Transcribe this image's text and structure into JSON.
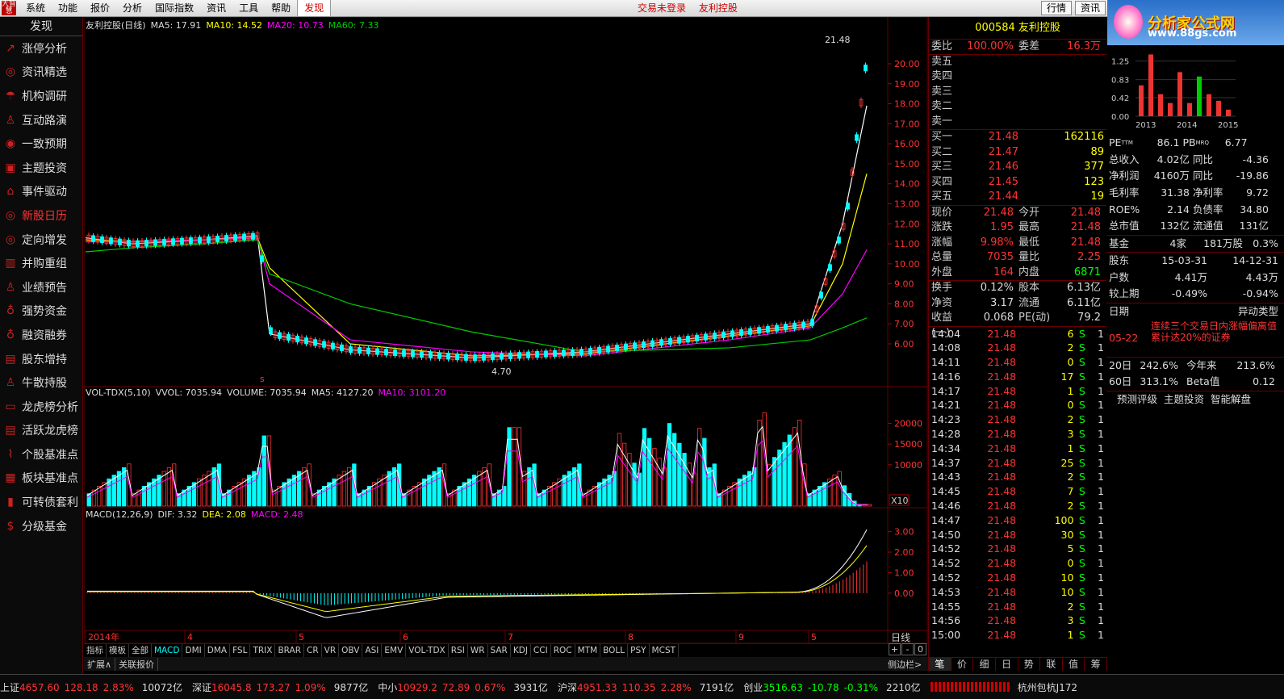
{
  "menubar": {
    "logo": "大智慧",
    "items": [
      "系统",
      "功能",
      "报价",
      "分析",
      "国际指数",
      "资讯",
      "工具",
      "帮助",
      "发现"
    ],
    "active": "发现",
    "center": [
      "交易未登录",
      "友利控股"
    ],
    "right_buttons": [
      "行情",
      "资讯"
    ]
  },
  "brand": {
    "title": "分析家公式网",
    "url": "www.88gs.com"
  },
  "sidebar": {
    "title": "发现",
    "items": [
      {
        "label": "涨停分析",
        "icon": "trend-icon"
      },
      {
        "label": "资讯精选",
        "icon": "globe-icon"
      },
      {
        "label": "机构调研",
        "icon": "umbrella-icon"
      },
      {
        "label": "互动路演",
        "icon": "person-icon"
      },
      {
        "label": "一致预期",
        "icon": "coins-icon"
      },
      {
        "label": "主题投资",
        "icon": "frame-icon"
      },
      {
        "label": "事件驱动",
        "icon": "bank-icon"
      },
      {
        "label": "新股日历",
        "icon": "globe-icon",
        "hot": true
      },
      {
        "label": "定向增发",
        "icon": "globe-icon"
      },
      {
        "label": "并购重组",
        "icon": "building-icon"
      },
      {
        "label": "业绩预告",
        "icon": "person-icon"
      },
      {
        "label": "强势资金",
        "icon": "moneybag-icon"
      },
      {
        "label": "融资融券",
        "icon": "moneybag-icon"
      },
      {
        "label": "股东增持",
        "icon": "doc-icon"
      },
      {
        "label": "牛散持股",
        "icon": "person-icon"
      },
      {
        "label": "龙虎榜分析",
        "icon": "briefcase-icon"
      },
      {
        "label": "活跃龙虎榜",
        "icon": "doc-icon"
      },
      {
        "label": "个股基准点",
        "icon": "chart-icon"
      },
      {
        "label": "板块基准点",
        "icon": "grid-icon"
      },
      {
        "label": "可转债套利",
        "icon": "bars-icon"
      },
      {
        "label": "分级基金",
        "icon": "coin-icon"
      }
    ]
  },
  "chart": {
    "main_title": "友利控股(日线)",
    "ma5": "MA5: 17.91",
    "ma10": "MA10: 14.52",
    "ma20": "MA20: 10.73",
    "ma60": "MA60: 7.33",
    "price_ticks": [
      "20.00",
      "19.00",
      "18.00",
      "17.00",
      "16.00",
      "15.00",
      "14.00",
      "13.00",
      "12.00",
      "11.00",
      "10.00",
      "9.00",
      "8.00",
      "7.00",
      "6.00"
    ],
    "high_label": "21.48",
    "low_label": "4.70",
    "marker_s": "s",
    "vol_title": "VOL-TDX(5,10)",
    "vvol": "VVOL: 7035.94",
    "volume": "VOLUME: 7035.94",
    "vol_ma5": "MA5: 4127.20",
    "vol_ma10": "MA10: 3101.20",
    "vol_ticks": [
      "20000",
      "15000",
      "10000"
    ],
    "vol_unit": "X10",
    "macd_title": "MACD(12,26,9)",
    "dif": "DIF: 3.32",
    "dea": "DEA: 2.08",
    "macd": "MACD: 2.48",
    "macd_ticks": [
      "3.00",
      "2.00",
      "1.00",
      "0.00"
    ],
    "date_labels": [
      "2014年",
      "4",
      "5",
      "6",
      "7",
      "8",
      "9",
      "5"
    ],
    "period": "日线"
  },
  "chart_data": {
    "type": "line",
    "title": "友利控股(日线)",
    "ylim": [
      4.7,
      21.48
    ],
    "x": [
      "2014年",
      "4",
      "5",
      "6",
      "7",
      "8",
      "9",
      "5"
    ],
    "series": [
      {
        "name": "MA5",
        "values": [
          11.3,
          11.0,
          11.2,
          11.4,
          6.5,
          5.7,
          5.3,
          5.6,
          6.5,
          7.0,
          12.0,
          17.9
        ]
      },
      {
        "name": "MA10",
        "values": [
          11.2,
          11.1,
          11.2,
          11.3,
          9.8,
          6.0,
          5.4,
          5.5,
          6.4,
          6.9,
          10.0,
          14.5
        ]
      },
      {
        "name": "MA20",
        "values": [
          11.1,
          11.1,
          11.2,
          11.3,
          9.0,
          6.2,
          5.6,
          5.4,
          6.2,
          6.8,
          8.5,
          10.7
        ]
      },
      {
        "name": "MA60",
        "values": [
          10.6,
          10.8,
          11.0,
          11.2,
          9.5,
          8.0,
          6.6,
          5.6,
          5.8,
          6.2,
          6.8,
          7.3
        ]
      }
    ]
  },
  "tabs": [
    "指标",
    "模板",
    "全部",
    "MACD",
    "DMI",
    "DMA",
    "FSL",
    "TRIX",
    "BRAR",
    "CR",
    "VR",
    "OBV",
    "ASI",
    "EMV",
    "VOL-TDX",
    "RSI",
    "WR",
    "SAR",
    "KDJ",
    "CCI",
    "ROC",
    "MTM",
    "BOLL",
    "PSY",
    "MCST"
  ],
  "active_tab": "MACD",
  "tabs2": [
    "扩展∧",
    "关联报价"
  ],
  "zoom": [
    "+",
    "-",
    "0"
  ],
  "side_toggle": "侧边栏>",
  "quote": {
    "code": "000584",
    "name": "友利控股",
    "weibi_label": "委比",
    "weibi": "100.00%",
    "weicha_label": "委差",
    "weicha": "16.3万",
    "sell": [
      "卖五",
      "卖四",
      "卖三",
      "卖二",
      "卖一"
    ],
    "buy": [
      {
        "l": "买一",
        "p": "21.48",
        "v": "162116"
      },
      {
        "l": "买二",
        "p": "21.47",
        "v": "89"
      },
      {
        "l": "买三",
        "p": "21.46",
        "v": "377"
      },
      {
        "l": "买四",
        "p": "21.45",
        "v": "123"
      },
      {
        "l": "买五",
        "p": "21.44",
        "v": "19"
      }
    ],
    "stats": [
      {
        "a": "现价",
        "b": "21.48",
        "c": "今开",
        "d": "21.48"
      },
      {
        "a": "涨跌",
        "b": "1.95",
        "c": "最高",
        "d": "21.48"
      },
      {
        "a": "涨幅",
        "b": "9.98%",
        "c": "最低",
        "d": "21.48"
      },
      {
        "a": "总量",
        "b": "7035",
        "c": "量比",
        "d": "2.25"
      },
      {
        "a": "外盘",
        "b": "164",
        "c": "内盘",
        "d": "6871"
      }
    ],
    "stats2": [
      {
        "a": "换手",
        "b": "0.12%",
        "c": "股本",
        "d": "6.13亿"
      },
      {
        "a": "净资",
        "b": "3.17",
        "c": "流通",
        "d": "6.11亿"
      },
      {
        "a": "收益(一)",
        "b": "0.068",
        "c": "PE(动)",
        "d": "79.2"
      }
    ],
    "ticks": [
      {
        "t": "14:04",
        "p": "21.48",
        "v": "6",
        "s": "S",
        "n": "1"
      },
      {
        "t": "14:08",
        "p": "21.48",
        "v": "2",
        "s": "S",
        "n": "1"
      },
      {
        "t": "14:11",
        "p": "21.48",
        "v": "0",
        "s": "S",
        "n": "1"
      },
      {
        "t": "14:16",
        "p": "21.48",
        "v": "17",
        "s": "S",
        "n": "1"
      },
      {
        "t": "14:17",
        "p": "21.48",
        "v": "1",
        "s": "S",
        "n": "1"
      },
      {
        "t": "14:21",
        "p": "21.48",
        "v": "0",
        "s": "S",
        "n": "1"
      },
      {
        "t": "14:23",
        "p": "21.48",
        "v": "2",
        "s": "S",
        "n": "1"
      },
      {
        "t": "14:28",
        "p": "21.48",
        "v": "3",
        "s": "S",
        "n": "1"
      },
      {
        "t": "14:34",
        "p": "21.48",
        "v": "1",
        "s": "S",
        "n": "1"
      },
      {
        "t": "14:37",
        "p": "21.48",
        "v": "25",
        "s": "S",
        "n": "1"
      },
      {
        "t": "14:43",
        "p": "21.48",
        "v": "2",
        "s": "S",
        "n": "1"
      },
      {
        "t": "14:45",
        "p": "21.48",
        "v": "7",
        "s": "S",
        "n": "1"
      },
      {
        "t": "14:46",
        "p": "21.48",
        "v": "2",
        "s": "S",
        "n": "1"
      },
      {
        "t": "14:47",
        "p": "21.48",
        "v": "100",
        "s": "S",
        "n": "1"
      },
      {
        "t": "14:50",
        "p": "21.48",
        "v": "30",
        "s": "S",
        "n": "1"
      },
      {
        "t": "14:52",
        "p": "21.48",
        "v": "5",
        "s": "S",
        "n": "1"
      },
      {
        "t": "14:52",
        "p": "21.48",
        "v": "0",
        "s": "S",
        "n": "1"
      },
      {
        "t": "14:52",
        "p": "21.48",
        "v": "10",
        "s": "S",
        "n": "1"
      },
      {
        "t": "14:53",
        "p": "21.48",
        "v": "10",
        "s": "S",
        "n": "1"
      },
      {
        "t": "14:55",
        "p": "21.48",
        "v": "2",
        "s": "S",
        "n": "1"
      },
      {
        "t": "14:56",
        "p": "21.48",
        "v": "3",
        "s": "S",
        "n": "1"
      },
      {
        "t": "15:00",
        "p": "21.48",
        "v": "1",
        "s": "S",
        "n": "1"
      }
    ],
    "bottom_tabs": [
      "笔",
      "价",
      "细",
      "日",
      "势",
      "联",
      "值",
      "筹"
    ]
  },
  "fin": {
    "mini_ticks": [
      "1.25",
      "0.83",
      "0.42",
      "0.00"
    ],
    "mini_years": [
      "2013",
      "2014",
      "2015"
    ],
    "mini_bars": [
      0.7,
      1.4,
      0.5,
      0.3,
      1.0,
      0.3,
      0.9,
      0.5,
      0.35,
      0.15
    ],
    "rows": [
      {
        "a": "PE",
        "sup": "TTM",
        "b": "86.1",
        "c": "PB",
        "sup2": "MRQ",
        "d": "6.77"
      },
      {
        "a": "总收入",
        "b": "4.02亿",
        "c": "同比",
        "d": "-4.36"
      },
      {
        "a": "净利润",
        "b": "4160万",
        "c": "同比",
        "d": "-19.86"
      },
      {
        "a": "毛利率",
        "b": "31.38",
        "c": "净利率",
        "d": "9.72"
      },
      {
        "a": "ROE%",
        "b": "2.14",
        "c": "负债率",
        "d": "34.80"
      },
      {
        "a": "总市值",
        "b": "132亿",
        "c": "流通值",
        "d": "131亿"
      }
    ],
    "fund": {
      "a": "基金",
      "b": "4家",
      "c": "181万股",
      "d": "0.3%"
    },
    "holders": [
      {
        "a": "股东",
        "b": "15-03-31",
        "c": "14-12-31"
      },
      {
        "a": "户数",
        "b": "4.41万",
        "c": "4.43万"
      },
      {
        "a": "较上期",
        "b": "-0.49%",
        "c": "-0.94%"
      }
    ],
    "event_header": {
      "a": "日期",
      "b": "异动类型"
    },
    "event": {
      "date": "05-22",
      "text": "连续三个交易日内涨幅偏离值累计达20%的证券"
    },
    "perf": [
      {
        "a": "20日",
        "b": "242.6%",
        "c": "今年来",
        "d": "213.6%"
      },
      {
        "a": "60日",
        "b": "313.1%",
        "c": "Beta值",
        "d": "0.12"
      }
    ],
    "links": [
      "预测评级",
      "主题投资",
      "智能解盘"
    ]
  },
  "status": [
    {
      "name": "上证",
      "val": "4657.60",
      "chg": "128.18",
      "pct": "2.83%",
      "amt": "10072亿"
    },
    {
      "name": "深证",
      "val": "16045.8",
      "chg": "173.27",
      "pct": "1.09%",
      "amt": "9877亿"
    },
    {
      "name": "中小",
      "val": "10929.2",
      "chg": "72.89",
      "pct": "0.67%",
      "amt": "3931亿"
    },
    {
      "name": "沪深",
      "val": "4951.33",
      "chg": "110.35",
      "pct": "2.28%",
      "amt": "7191亿"
    },
    {
      "name": "创业",
      "val": "3516.63",
      "chg": "-10.78",
      "pct": "-0.31%",
      "amt": "2210亿"
    }
  ],
  "status_extra": "杭州包杭J172",
  "colors": {
    "up": "#ff3333",
    "down": "#00ff00",
    "cyan": "#00ffff",
    "ma5": "#ffffff",
    "ma10": "#ffff00",
    "ma20": "#ff00ff",
    "ma60": "#00cc00",
    "grid": "#660000"
  }
}
